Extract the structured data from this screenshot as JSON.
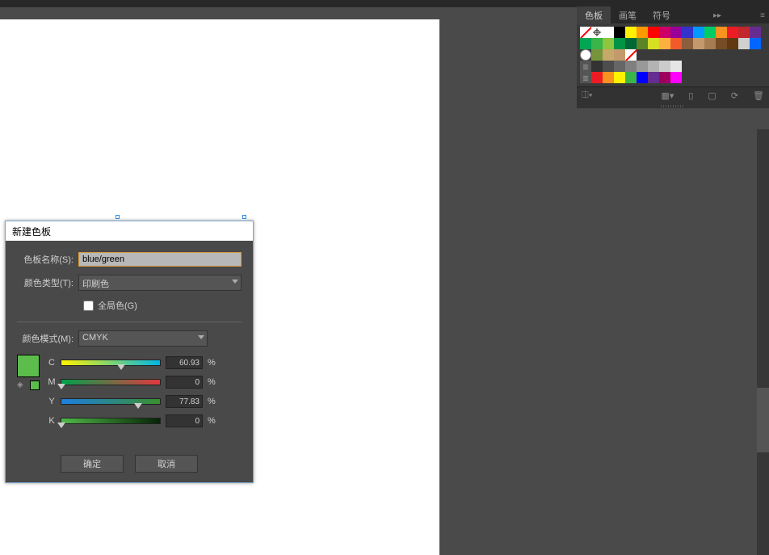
{
  "panel": {
    "tabs": [
      "色板",
      "画笔",
      "符号"
    ],
    "active_tab": 0,
    "swatch_rows": [
      [
        "none",
        "reg",
        "#ffffff",
        "#000000",
        "#fff200",
        "#ff9900",
        "#ff0000",
        "#cc0066",
        "#990099",
        "#3333cc",
        "#0099ff",
        "#00cc66",
        "#f7931e",
        "#ed1c24",
        "#c1272d",
        "#662d91"
      ],
      [
        "#00a651",
        "#39b54a",
        "#8dc63f",
        "#009444",
        "#006837",
        "#598527",
        "#d7df23",
        "#fbb040",
        "#f15a29",
        "#8b5e3c",
        "#c49a6c",
        "#a67c52",
        "#754c24",
        "#603913",
        "#d0d0d0",
        "#0066ff"
      ],
      [
        "empty",
        "#77933c",
        "#c5a96b",
        "#c49a6c",
        "none2",
        "",
        "",
        "",
        "",
        "",
        "",
        "",
        "",
        "",
        "",
        ""
      ],
      [
        "folder",
        "#333333",
        "#4d4d4d",
        "#666666",
        "#808080",
        "#999999",
        "#b3b3b3",
        "#cccccc",
        "#e6e6e6",
        "",
        "",
        "",
        "",
        "",
        "",
        ""
      ],
      [
        "folder",
        "#ed1c24",
        "#f7931e",
        "#fff200",
        "#39b54a",
        "#0000ff",
        "#662d91",
        "#9e005d",
        "#ff00ff",
        "",
        "",
        "",
        "",
        "",
        "",
        ""
      ]
    ],
    "footer_icons": [
      "⊞",
      "▦",
      "▯",
      "▢",
      "⟳",
      "🗑"
    ]
  },
  "dialog": {
    "title": "新建色板",
    "name_label": "色板名称(S):",
    "name_value": "blue/green",
    "type_label": "颜色类型(T):",
    "type_value": "印刷色",
    "global_label": "全局色(G)",
    "global_checked": false,
    "mode_label": "颜色模式(M):",
    "mode_value": "CMYK",
    "channels": {
      "C": {
        "value": "60.93",
        "percent": 60.93
      },
      "M": {
        "value": "0",
        "percent": 0
      },
      "Y": {
        "value": "77.83",
        "percent": 77.83
      },
      "K": {
        "value": "0",
        "percent": 0
      }
    },
    "unit": "%",
    "preview_color": "#5cbd4c",
    "ok": "确定",
    "cancel": "取消"
  }
}
